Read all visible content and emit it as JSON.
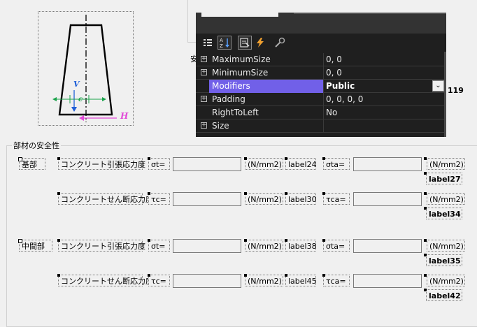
{
  "diagram": {
    "label_v": "V",
    "label_c": "c",
    "label_h": "H"
  },
  "background": {
    "partial_glyph_left": "安",
    "partial_label_right": "119"
  },
  "property_grid": {
    "toolbar": [
      "categorized-icon",
      "alphabetical-icon",
      "properties-icon",
      "events-icon",
      "property-pages-icon"
    ],
    "rows": [
      {
        "name": "MaximumSize",
        "value": "0, 0",
        "expandable": true
      },
      {
        "name": "MinimumSize",
        "value": "0, 0",
        "expandable": true
      },
      {
        "name": "Modifiers",
        "value": "Public",
        "expandable": false,
        "selected": true
      },
      {
        "name": "Padding",
        "value": "0, 0, 0, 0",
        "expandable": true
      },
      {
        "name": "RightToLeft",
        "value": "No",
        "expandable": false
      },
      {
        "name": "Size",
        "value": "",
        "expandable": true
      }
    ]
  },
  "group": {
    "title": "部材の安全性"
  },
  "sections": [
    {
      "label": "基部",
      "rows": [
        {
          "stress": "コンクリート引張応力度",
          "sym": "σt=",
          "unit": "(N/mm2)",
          "ref": "label24",
          "sym_a": "σta=",
          "unit_a": "(N/mm2)",
          "result": "label27"
        },
        {
          "stress": "コンクリートせん断応力度",
          "sym": "τc=",
          "unit": "(N/mm2)",
          "ref": "label30",
          "sym_a": "τca=",
          "unit_a": "(N/mm2)",
          "result": "label34"
        }
      ]
    },
    {
      "label": "中間部",
      "rows": [
        {
          "stress": "コンクリート引張応力度",
          "sym": "σt=",
          "unit": "(N/mm2)",
          "ref": "label38",
          "sym_a": "σta=",
          "unit_a": "(N/mm2)",
          "result": "label35"
        },
        {
          "stress": "コンクリートせん断応力度",
          "sym": "τc=",
          "unit": "(N/mm2)",
          "ref": "label45",
          "sym_a": "τca=",
          "unit_a": "(N/mm2)",
          "result": "label42"
        }
      ]
    }
  ]
}
